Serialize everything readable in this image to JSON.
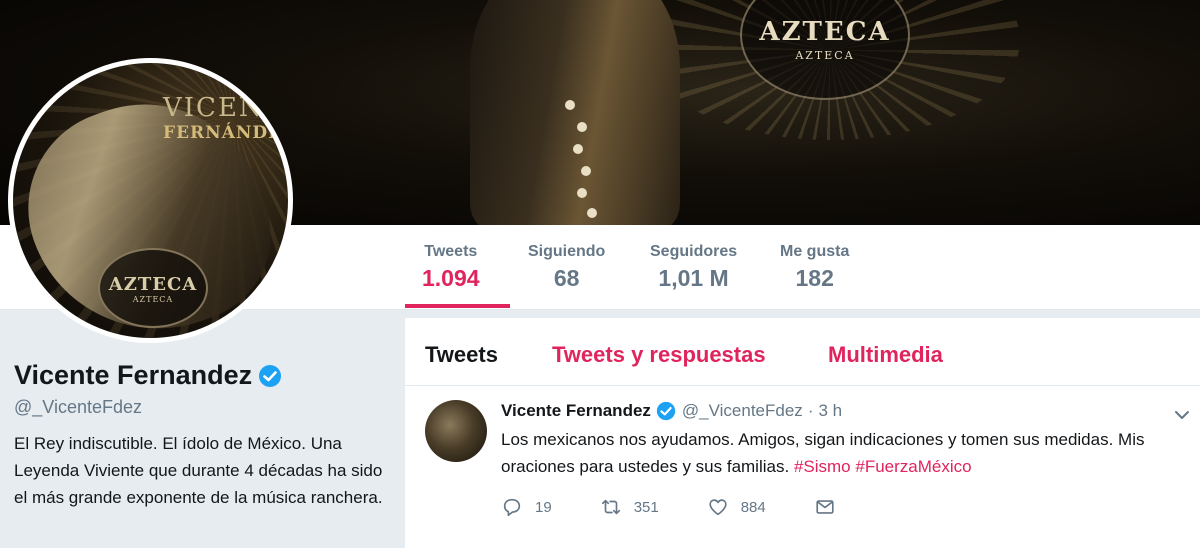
{
  "banner": {
    "logo_title": "AZTECA",
    "logo_subtitle": "AZTECA"
  },
  "avatar": {
    "name_line1": "VICENTE",
    "name_line2": "FERNÁNDEZ",
    "badge_title": "AZTECA",
    "badge_subtitle": "AZTECA"
  },
  "stats": [
    {
      "label": "Tweets",
      "value": "1.094",
      "active": true
    },
    {
      "label": "Siguiendo",
      "value": "68",
      "active": false
    },
    {
      "label": "Seguidores",
      "value": "1,01 M",
      "active": false
    },
    {
      "label": "Me gusta",
      "value": "182",
      "active": false
    }
  ],
  "profile": {
    "name": "Vicente Fernandez",
    "handle": "@_VicenteFdez",
    "bio": "El Rey indiscutible. El ídolo de México. Una Leyenda Viviente que durante 4 décadas ha sido el más grande exponente de la música ranchera."
  },
  "tabs": [
    {
      "label": "Tweets",
      "active": true
    },
    {
      "label": "Tweets y respuestas",
      "active": false
    },
    {
      "label": "Multimedia",
      "active": false
    }
  ],
  "tweet": {
    "name": "Vicente Fernandez",
    "handle": "@_VicenteFdez",
    "dot": "·",
    "time": "3 h",
    "text": "Los mexicanos nos ayudamos. Amigos, sigan indicaciones y tomen sus medidas. Mis oraciones para ustedes y sus familias.",
    "hashtag1": "#Sismo",
    "hashtag2": "#FuerzaMéxico",
    "replies": "19",
    "retweets": "351",
    "likes": "884"
  },
  "colors": {
    "accent": "#e0245e",
    "verified": "#1da1f2",
    "muted": "#657786"
  }
}
